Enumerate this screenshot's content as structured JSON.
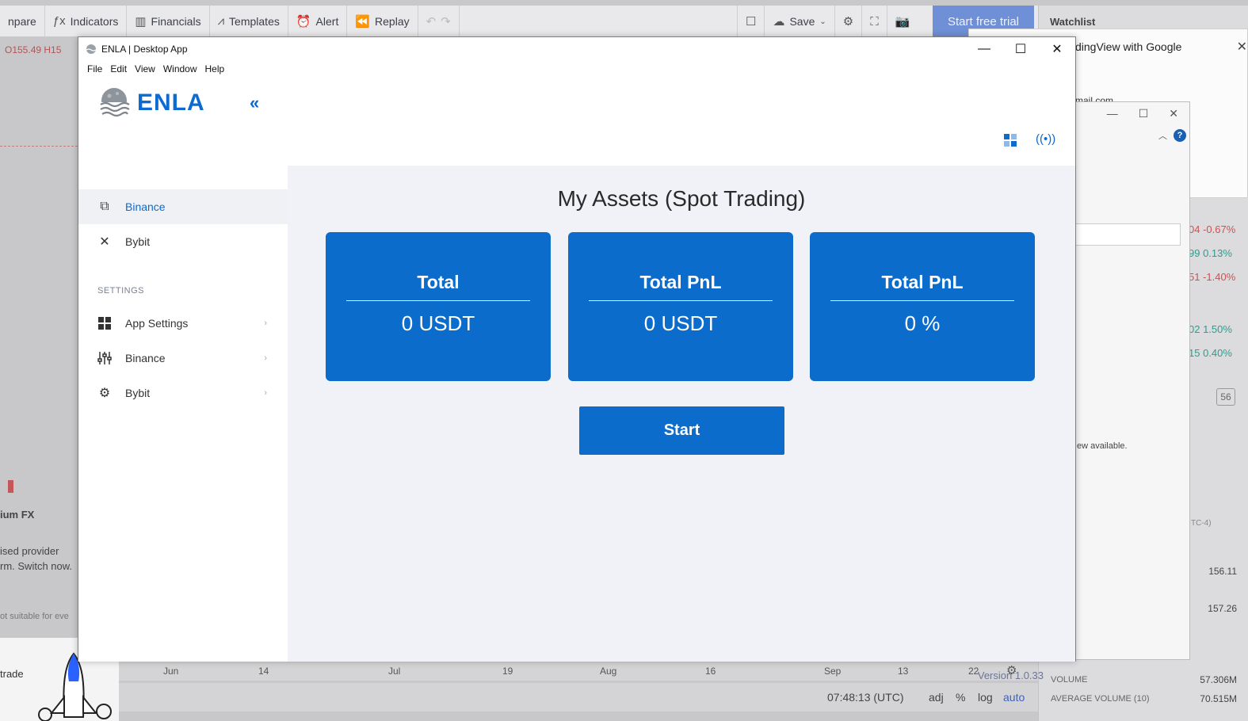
{
  "background_app": {
    "toolbar": [
      {
        "label": "npare",
        "icon": ""
      },
      {
        "label": "Indicators",
        "icon": "fx-icon"
      },
      {
        "label": "Financials",
        "icon": "bar-chart-icon"
      },
      {
        "label": "Templates",
        "icon": "templates-icon"
      },
      {
        "label": "Alert",
        "icon": "alarm-clock-icon"
      },
      {
        "label": "Replay",
        "icon": "rewind-icon"
      }
    ],
    "save_label": "Save",
    "trial_label": "Start free trial",
    "price_text": "O155.49  H15",
    "side_texts": [
      "ium FX",
      "ised provider",
      "rm. Switch now.",
      "ot suitable for eve"
    ],
    "promo_text": "trade",
    "axis_labels": [
      "Jun",
      "14",
      "Jul",
      "19",
      "Aug",
      "16",
      "Sep",
      "13",
      "22"
    ],
    "status": {
      "time": "07:48:13 (UTC)",
      "adj": "adj",
      "percent": "%",
      "log": "log",
      "auto": "auto"
    },
    "watchlist_label": "Watchlist",
    "google_popup": {
      "title": "dingView with Google",
      "email": "mail.com"
    },
    "small_window_text": "ew available.",
    "right_ticks": [
      {
        "text": "04  -0.67%",
        "color": "#d05050"
      },
      {
        "text": "99   0.13%",
        "color": "#2a9d8f"
      },
      {
        "text": "51  -1.40%",
        "color": "#d05050"
      },
      {
        "text": "02   1.50%",
        "color": "#2a9d8f"
      },
      {
        "text": "15   0.40%",
        "color": "#2a9d8f"
      }
    ],
    "right_badge": "56",
    "right_tz": "TC-4)",
    "right_prices": [
      "156.11",
      "157.26"
    ],
    "right_stats": [
      {
        "label": "VOLUME",
        "value": "57.306M"
      },
      {
        "label": "AVERAGE VOLUME (10)",
        "value": "70.515M"
      }
    ]
  },
  "window": {
    "title": "ENLA | Desktop App",
    "menu": [
      "File",
      "Edit",
      "View",
      "Window",
      "Help"
    ]
  },
  "sidebar": {
    "logo_text": "ENLA",
    "nav": [
      {
        "label": "Binance",
        "icon": "binance-copy-icon",
        "active": true
      },
      {
        "label": "Bybit",
        "icon": "bybit-x-icon",
        "active": false
      }
    ],
    "settings_header": "SETTINGS",
    "settings": [
      {
        "label": "App Settings",
        "icon": "grid-icon"
      },
      {
        "label": "Binance",
        "icon": "sliders-icon"
      },
      {
        "label": "Bybit",
        "icon": "gear-icon"
      }
    ]
  },
  "main": {
    "page_title": "My Assets (Spot Trading)",
    "cards": [
      {
        "label": "Total",
        "value": "0 USDT"
      },
      {
        "label": "Total PnL",
        "value": "0 USDT"
      },
      {
        "label": "Total PnL",
        "value": "0 %"
      }
    ],
    "start_label": "Start",
    "version": "Version 1.0.33"
  },
  "colors": {
    "accent": "#0b6ccc",
    "card_text": "#ffffff",
    "content_bg": "#f1f2f7"
  }
}
